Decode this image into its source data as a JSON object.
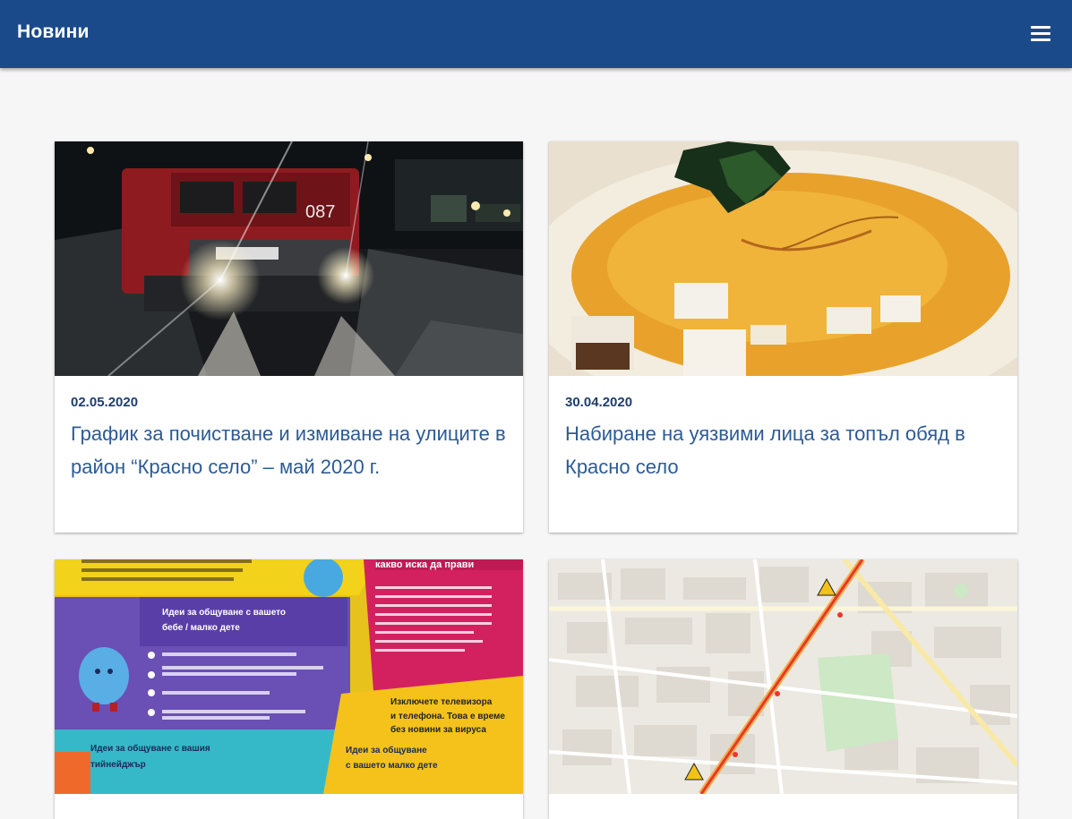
{
  "header": {
    "title": "Новини",
    "menu_icon": "hamburger-menu-icon",
    "background_color": "#1a4a8a"
  },
  "cards": [
    {
      "date": "02.05.2020",
      "title": "График за почистване и измиване на улиците в район “Красно село” – май 2020 г.",
      "image": "street-sweeper-truck-at-night",
      "truck_number": "087"
    },
    {
      "date": "30.04.2020",
      "title": "Набиране на уязвими лица за топъл обяд в Красно село",
      "image": "pumpkin-soup-with-croutons"
    },
    {
      "image": "parenting-infographic",
      "infographic": {
        "heading_top": "какво иска да прави",
        "baby_heading": "Идеи за общуване с вашето бебе / малко дете",
        "teen_heading": "Идеи за общуване с вашия тийнейджър",
        "tv_text": "Изключете телевизора и телефона. Това е време без новини за вируса",
        "toddler_heading": "Идеи за общуване с вашето малко дете"
      }
    },
    {
      "image": "street-map-repair-route"
    }
  ]
}
